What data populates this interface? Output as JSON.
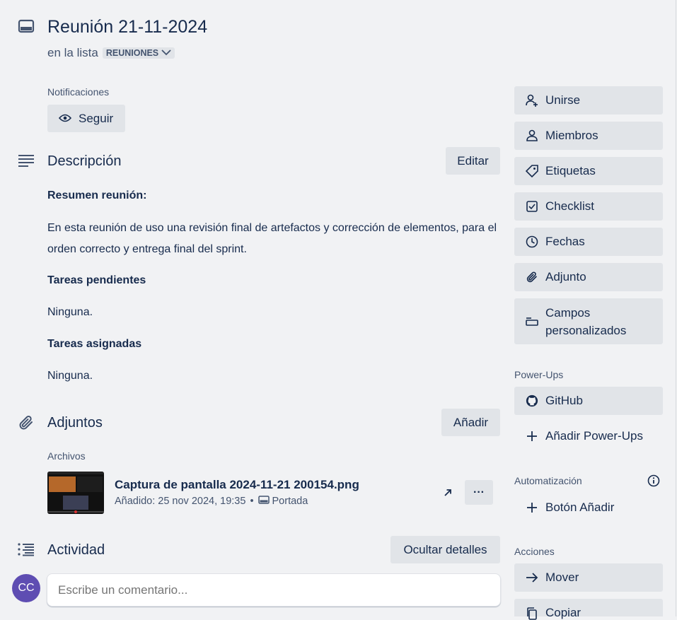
{
  "card": {
    "title": "Reunión 21-11-2024",
    "in_list_prefix": "en la lista",
    "list_name": "REUNIONES"
  },
  "notifications": {
    "label": "Notificaciones",
    "follow_button": "Seguir"
  },
  "description": {
    "heading": "Descripción",
    "edit_button": "Editar",
    "summary_title": "Resumen reunión:",
    "summary_text": "En esta reunión de uso una revisión final de artefactos y corrección de elementos, para el orden correcto y entrega final del sprint.",
    "pending_title": "Tareas pendientes",
    "pending_text": "Ninguna.",
    "assigned_title": "Tareas asignadas",
    "assigned_text": "Ninguna."
  },
  "attachments": {
    "heading": "Adjuntos",
    "add_button": "Añadir",
    "files_label": "Archivos",
    "file": {
      "name": "Captura de pantalla 2024-11-21 200154.png",
      "added": "Añadido: 25 nov 2024, 19:35",
      "separator": "•",
      "cover_label": "Portada",
      "menu": "···"
    }
  },
  "activity": {
    "heading": "Actividad",
    "hide_details_button": "Ocultar detalles",
    "avatar_initials": "CC",
    "comment_placeholder": "Escribe un comentario..."
  },
  "sidebar": {
    "items": [
      {
        "label": "Unirse",
        "icon": "add-person-icon"
      },
      {
        "label": "Miembros",
        "icon": "person-icon"
      },
      {
        "label": "Etiquetas",
        "icon": "tag-icon"
      },
      {
        "label": "Checklist",
        "icon": "checkbox-icon"
      },
      {
        "label": "Fechas",
        "icon": "clock-icon"
      },
      {
        "label": "Adjunto",
        "icon": "paperclip-icon"
      },
      {
        "label": "Campos personalizados",
        "icon": "custom-fields-icon"
      }
    ],
    "powerups_label": "Power-Ups",
    "github_label": "GitHub",
    "add_powerups_label": "Añadir Power-Ups",
    "automation_label": "Automatización",
    "add_button_label": "Botón Añadir",
    "actions_label": "Acciones",
    "move_label": "Mover",
    "copy_label": "Copiar"
  },
  "colors": {
    "background": "#f1f2f4",
    "button": "#e1e4e8",
    "text": "#172b4d",
    "subtle": "#44546f",
    "avatar": "#5e4db2"
  }
}
